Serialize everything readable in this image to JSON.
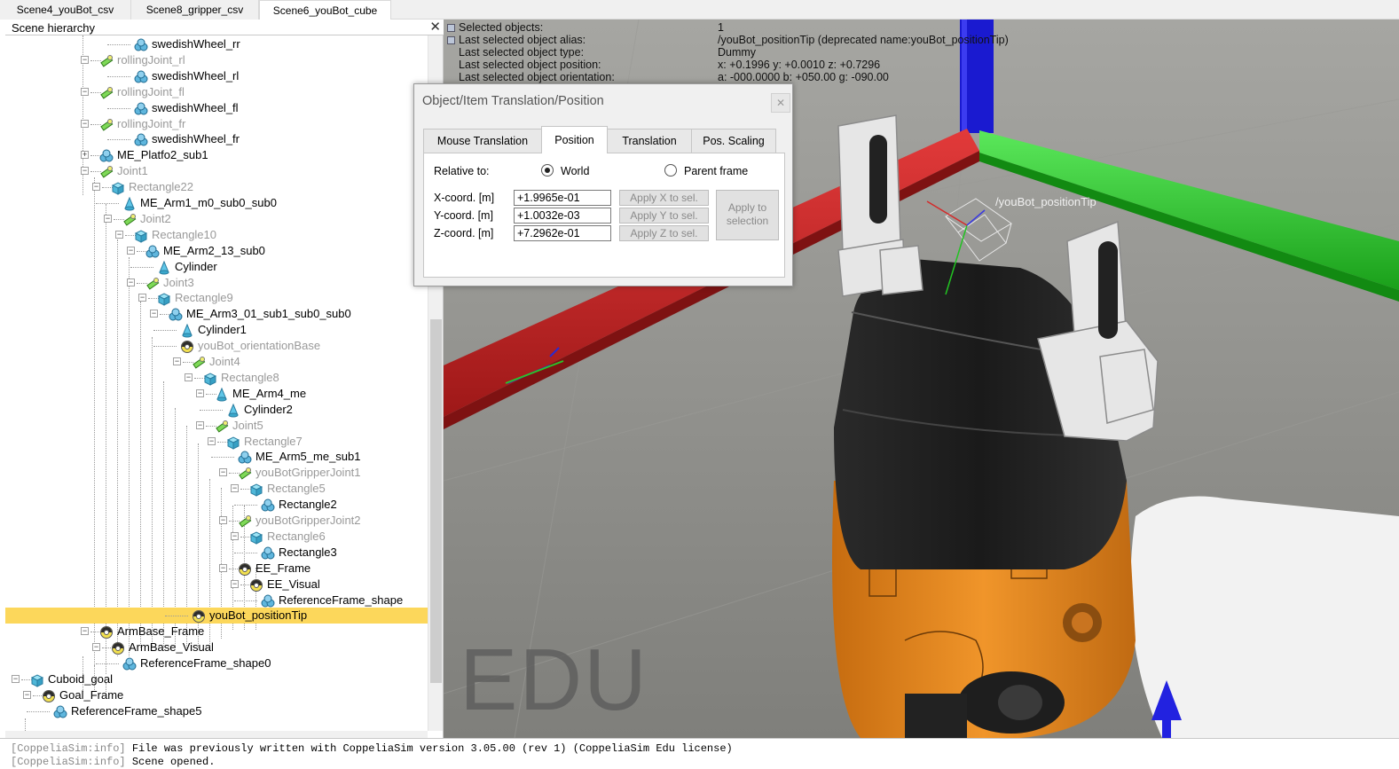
{
  "tabs": [
    {
      "label": "Scene4_youBot_csv",
      "active": false
    },
    {
      "label": "Scene8_gripper_csv",
      "active": false
    },
    {
      "label": "Scene6_youBot_cube",
      "active": true
    }
  ],
  "hierarchy": {
    "title": "Scene hierarchy",
    "close_glyph": "✕",
    "items": [
      {
        "label": "swedishWheel_rr",
        "icon": "shape-icon",
        "dim": false
      },
      {
        "label": "rollingJoint_rl",
        "icon": "joint-icon",
        "dim": true
      },
      {
        "label": "swedishWheel_rl",
        "icon": "shape-icon",
        "dim": false
      },
      {
        "label": "rollingJoint_fl",
        "icon": "joint-icon",
        "dim": true
      },
      {
        "label": "swedishWheel_fl",
        "icon": "shape-icon",
        "dim": false
      },
      {
        "label": "rollingJoint_fr",
        "icon": "joint-icon",
        "dim": true
      },
      {
        "label": "swedishWheel_fr",
        "icon": "shape-icon",
        "dim": false
      },
      {
        "label": "ME_Platfo2_sub1",
        "icon": "shape-icon",
        "dim": false
      },
      {
        "label": "Joint1",
        "icon": "joint-icon",
        "dim": true
      },
      {
        "label": "Rectangle22",
        "icon": "cuboid-icon",
        "dim": true
      },
      {
        "label": "ME_Arm1_m0_sub0_sub0",
        "icon": "cylinder-icon",
        "dim": false
      },
      {
        "label": "Joint2",
        "icon": "joint-icon",
        "dim": true
      },
      {
        "label": "Rectangle10",
        "icon": "cuboid-icon",
        "dim": true
      },
      {
        "label": "ME_Arm2_13_sub0",
        "icon": "shape-icon",
        "dim": false
      },
      {
        "label": "Cylinder",
        "icon": "cylinder-icon",
        "dim": false
      },
      {
        "label": "Joint3",
        "icon": "joint-icon",
        "dim": true
      },
      {
        "label": "Rectangle9",
        "icon": "cuboid-icon",
        "dim": true
      },
      {
        "label": "ME_Arm3_01_sub1_sub0_sub0",
        "icon": "shape-icon",
        "dim": false
      },
      {
        "label": "Cylinder1",
        "icon": "cylinder-icon",
        "dim": false
      },
      {
        "label": "youBot_orientationBase",
        "icon": "dummy-icon",
        "dim": true
      },
      {
        "label": "Joint4",
        "icon": "joint-icon",
        "dim": true
      },
      {
        "label": "Rectangle8",
        "icon": "cuboid-icon",
        "dim": true
      },
      {
        "label": "ME_Arm4_me",
        "icon": "cylinder-icon",
        "dim": false
      },
      {
        "label": "Cylinder2",
        "icon": "cylinder-icon",
        "dim": false
      },
      {
        "label": "Joint5",
        "icon": "joint-icon",
        "dim": true
      },
      {
        "label": "Rectangle7",
        "icon": "cuboid-icon",
        "dim": true
      },
      {
        "label": "ME_Arm5_me_sub1",
        "icon": "shape-icon",
        "dim": false
      },
      {
        "label": "youBotGripperJoint1",
        "icon": "joint-icon",
        "dim": true
      },
      {
        "label": "Rectangle5",
        "icon": "cuboid-icon",
        "dim": true
      },
      {
        "label": "Rectangle2",
        "icon": "shape-icon",
        "dim": false
      },
      {
        "label": "youBotGripperJoint2",
        "icon": "joint-icon",
        "dim": true
      },
      {
        "label": "Rectangle6",
        "icon": "cuboid-icon",
        "dim": true
      },
      {
        "label": "Rectangle3",
        "icon": "shape-icon",
        "dim": false
      },
      {
        "label": "EE_Frame",
        "icon": "dummy-icon",
        "dim": false
      },
      {
        "label": "EE_Visual",
        "icon": "dummy-icon",
        "dim": false
      },
      {
        "label": "ReferenceFrame_shape",
        "icon": "shape-icon",
        "dim": false
      },
      {
        "label": "youBot_positionTip",
        "icon": "dummy-icon",
        "dim": false,
        "selected": true
      },
      {
        "label": "ArmBase_Frame",
        "icon": "dummy-icon",
        "dim": false
      },
      {
        "label": "ArmBase_Visual",
        "icon": "dummy-icon",
        "dim": false
      },
      {
        "label": "ReferenceFrame_shape0",
        "icon": "shape-icon",
        "dim": false
      },
      {
        "label": "Cuboid_goal",
        "icon": "cuboid-icon",
        "dim": false
      },
      {
        "label": "Goal_Frame",
        "icon": "dummy-icon",
        "dim": false
      },
      {
        "label": "ReferenceFrame_shape5",
        "icon": "shape-icon",
        "dim": false
      }
    ]
  },
  "info": {
    "rows": [
      {
        "key": "Selected objects:",
        "value": "1"
      },
      {
        "key": "Last selected object alias:",
        "value": "/youBot_positionTip   (deprecated name:youBot_positionTip)"
      },
      {
        "key": "Last selected object type:",
        "value": "Dummy"
      },
      {
        "key": "Last selected object position:",
        "value": "x: +0.1996    y: +0.0010    z: +0.7296"
      },
      {
        "key": "Last selected object orientation:",
        "value": "a: -000.0000    b: +050.00    g: -090.00"
      }
    ]
  },
  "viewport": {
    "watermark": "EDU",
    "object_label": "/youBot_positionTip"
  },
  "dialog": {
    "title": "Object/Item Translation/Position",
    "close_glyph": "✕",
    "tabs": [
      {
        "label": "Mouse Translation",
        "active": false
      },
      {
        "label": "Position",
        "active": true
      },
      {
        "label": "Translation",
        "active": false
      },
      {
        "label": "Pos. Scaling",
        "active": false
      }
    ],
    "relative_to_label": "Relative to:",
    "world_label": "World",
    "parent_label": "Parent frame",
    "relative_to_selected": "World",
    "x_label": "X-coord. [m]",
    "y_label": "Y-coord. [m]",
    "z_label": "Z-coord. [m]",
    "x_value": "+1.9965e-01",
    "y_value": "+1.0032e-03",
    "z_value": "+7.2962e-01",
    "apply_x": "Apply X to sel.",
    "apply_y": "Apply Y to sel.",
    "apply_z": "Apply Z to sel.",
    "apply_sel_line1": "Apply to",
    "apply_sel_line2": "selection"
  },
  "console": {
    "lines": [
      {
        "prefix": "[CoppeliaSim:info]",
        "text": " File was previously written with CoppeliaSim version 3.05.00 (rev 1) (CoppeliaSim Edu license)"
      },
      {
        "prefix": "[CoppeliaSim:info]",
        "text": " Scene opened."
      }
    ]
  },
  "colors": {
    "selection": "#fcd75b",
    "axis_x": "#d42a2a",
    "axis_y": "#22c322",
    "axis_z": "#1a1ad0",
    "robot_orange": "#e88a1a",
    "robot_black": "#1e1e1e"
  }
}
